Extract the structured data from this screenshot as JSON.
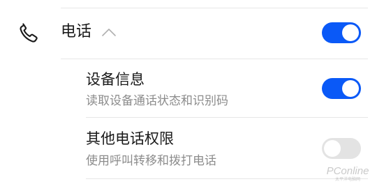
{
  "permission_group": {
    "icon": "phone-icon",
    "label": "电话",
    "expanded_indicator": "chevron-up-icon",
    "enabled": true
  },
  "items": [
    {
      "title": "设备信息",
      "description": "读取设备通话状态和识别码",
      "enabled": true
    },
    {
      "title": "其他电话权限",
      "description": "使用呼叫转移和拨打电话",
      "enabled": false
    }
  ],
  "watermark": {
    "text": "PConline",
    "subtext": "太平洋电脑网"
  },
  "colors": {
    "toggle_on": "#0a59f7",
    "toggle_off": "#e3e3e3",
    "primary_text": "#1a1a1a",
    "secondary_text": "#8c8c8c"
  }
}
